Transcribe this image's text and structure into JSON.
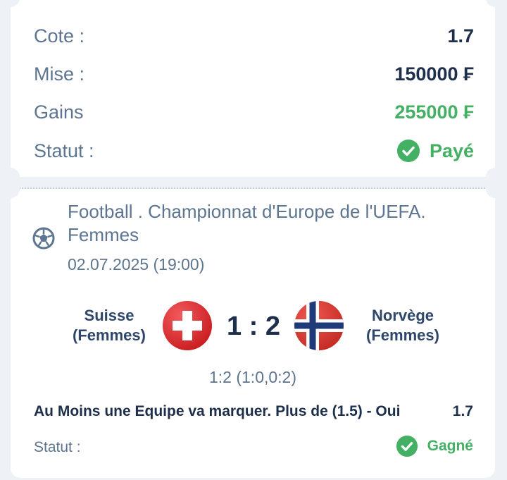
{
  "summary": {
    "odds_label": "Cote :",
    "odds_value": "1.7",
    "stake_label": "Mise :",
    "stake_value": "150000 ₣",
    "winnings_label": "Gains",
    "winnings_value": "255000 ₣",
    "status_label": "Statut :",
    "status_value": "Payé"
  },
  "event": {
    "league": "Football . Championnat d'Europe de l'UEFA. Femmes",
    "date": "02.07.2025 (19:00)",
    "home_team": "Suisse (Femmes)",
    "away_team": "Norvège (Femmes)",
    "score": "1 : 2",
    "score_detail": "1:2 (1:0,0:2)",
    "market": "Au Moins une Equipe va marquer. Plus de (1.5) - Oui",
    "market_odds": "1.7",
    "status_label": "Statut :",
    "status_value": "Gagné"
  },
  "colors": {
    "accent_green": "#44b064",
    "label_blue": "#5d7590",
    "dark_text": "#1d2f4a",
    "swiss_red": "#e2262a",
    "norway_red": "#d9312b",
    "norway_blue": "#1e3a78"
  },
  "icons": {
    "status": "check-circle-icon",
    "sport": "soccer-ball-icon",
    "home_flag": "switzerland-flag-icon",
    "away_flag": "norway-flag-icon"
  }
}
